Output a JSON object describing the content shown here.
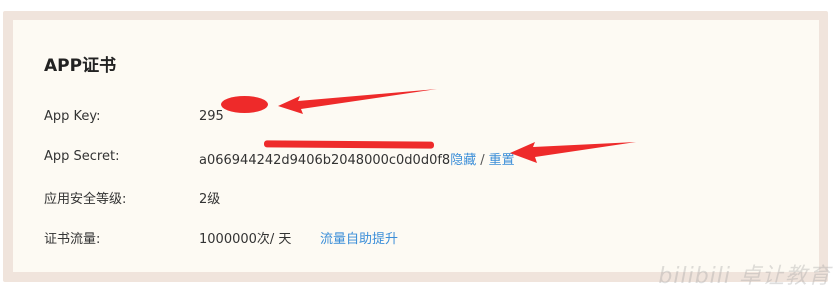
{
  "section": {
    "title": "APP证书"
  },
  "rows": {
    "app_key": {
      "label": "App Key:",
      "value": "295"
    },
    "app_secret": {
      "label": "App Secret:",
      "value": "a066944242d9406b2048000c0d0d0f8",
      "hide_link": "隐藏",
      "separator": "/",
      "reset_link": "重置"
    },
    "security_level": {
      "label": "应用安全等级:",
      "value": "2级"
    },
    "cert_traffic": {
      "label": "证书流量:",
      "value": "1000000次/ 天",
      "boost_link": "流量自助提升"
    }
  },
  "annotations": {
    "color": "#ee2a2a"
  },
  "watermark": {
    "text": "bilibili 卓让教育"
  }
}
